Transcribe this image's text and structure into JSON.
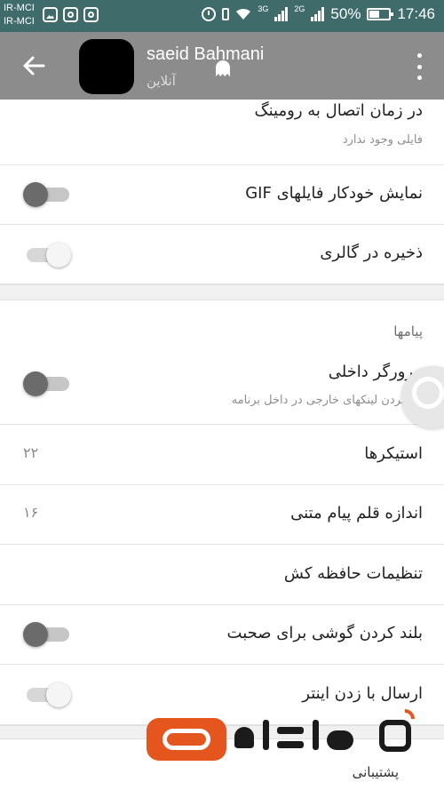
{
  "status_bar": {
    "carrier_1": "IR-MCI",
    "carrier_2": "IR-MCI",
    "network_1": "3G",
    "network_2": "2G",
    "battery": "50%",
    "time": "17:46"
  },
  "app_bar": {
    "title": "saeid Bahmani",
    "status": "آنلاین",
    "background": "#8c8c8c"
  },
  "settings": {
    "roaming": {
      "title": "در زمان اتصال به رومینگ",
      "subtitle": "فایلی وجود ندارد"
    },
    "gif_autoplay": {
      "title": "نمایش خودکار فایلهای GIF",
      "enabled": false
    },
    "save_to_gallery": {
      "title": "ذخیره در گالری",
      "enabled": false
    },
    "messages_section": "پیامها",
    "in_app_browser": {
      "title": "مرورگر داخلی",
      "subtitle": "باز کردن لینکهای خارجی در داخل برنامه",
      "enabled": false
    },
    "stickers": {
      "title": "استیکرها",
      "value": "۲۲"
    },
    "font_size": {
      "title": "اندازه قلم پیام متنی",
      "value": "۱۶"
    },
    "cache_settings": {
      "title": "تنظیمات حافظه کش"
    },
    "raise_to_speak": {
      "title": "بلند کردن گوشی برای صحبت",
      "enabled": false
    },
    "send_by_enter": {
      "title": "ارسال با زدن اینتر",
      "enabled": false
    }
  },
  "watermark": {
    "caption": "پشتیبانی",
    "brand_text": "آی‌تی رسان"
  }
}
